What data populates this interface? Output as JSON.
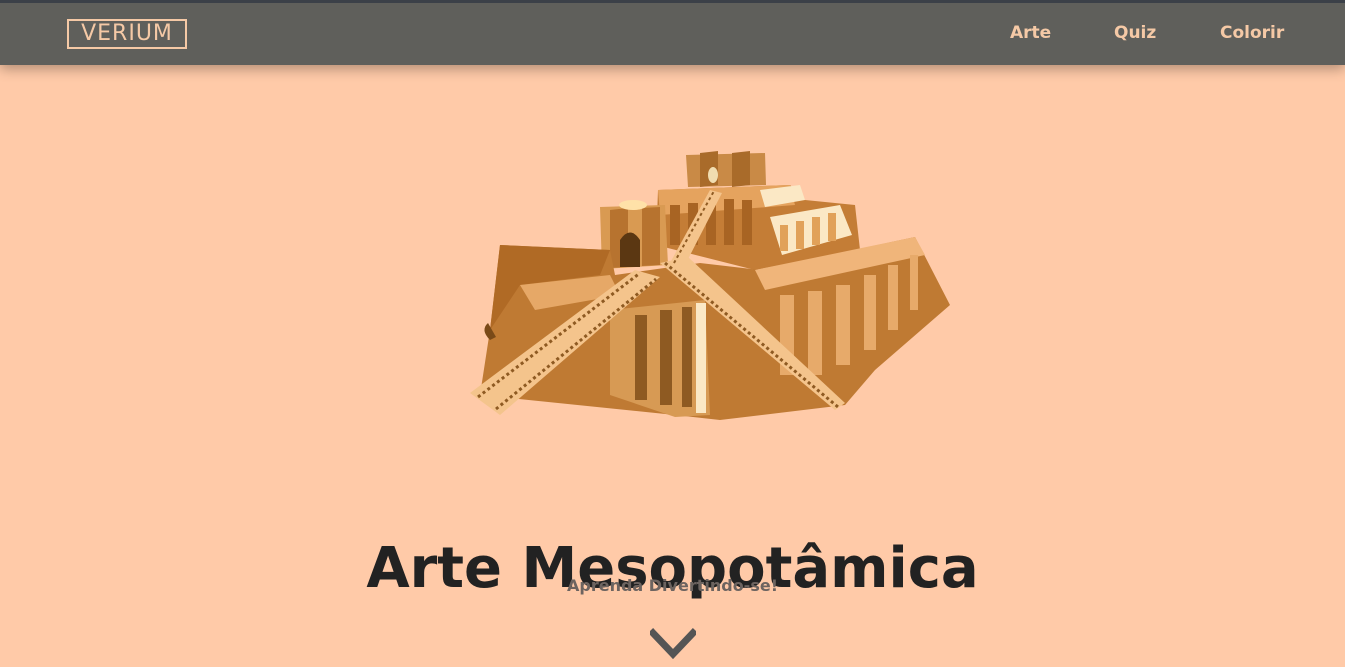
{
  "nav": {
    "logo": {
      "text": "VERIUM",
      "prefix": "VER",
      "special": "I",
      "suffix": "UM"
    },
    "links": [
      {
        "label": "Arte"
      },
      {
        "label": "Quiz"
      },
      {
        "label": "Colorir"
      }
    ]
  },
  "hero": {
    "illustration": "ziggurat-illustration",
    "title": "Arte Mesopotâmica",
    "subtitle": "Aprenda Divertindo-se!",
    "scroll_icon": "chevron-down-icon"
  },
  "colors": {
    "page_bg": "#ffcaa8",
    "nav_bg": "#5f5f5b",
    "nav_text": "#f5c9a6",
    "title": "#222222",
    "subtitle": "#6d6460",
    "chevron": "#555555"
  }
}
